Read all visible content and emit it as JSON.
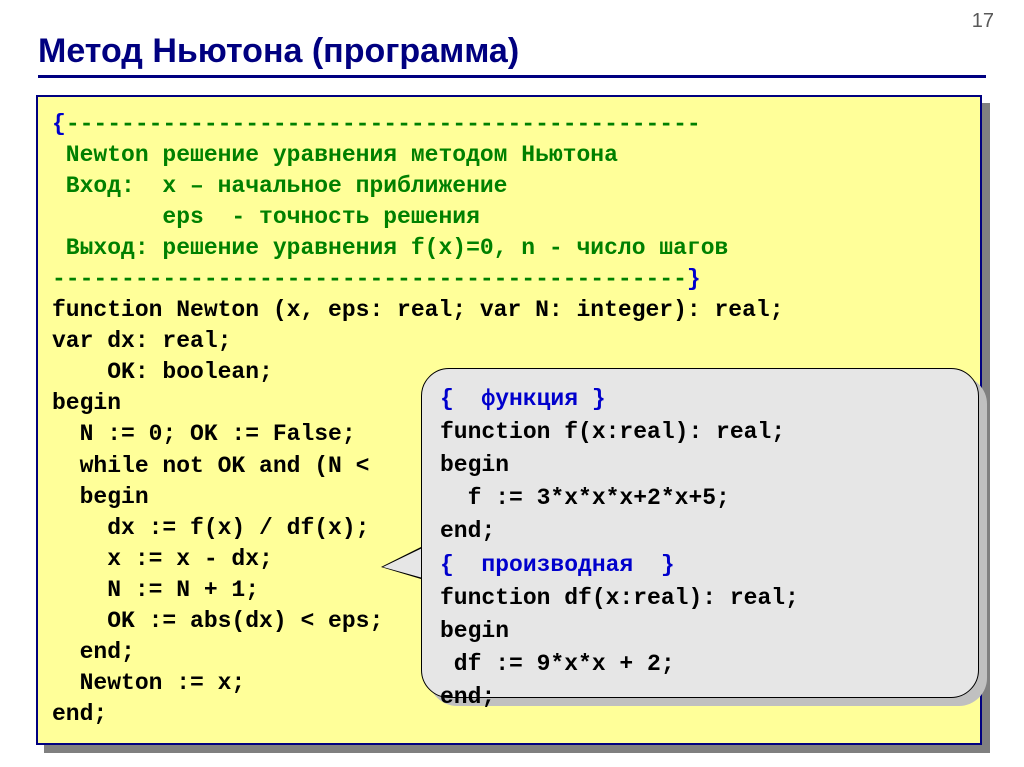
{
  "page_number": "17",
  "title": "Метод Ньютона (программа)",
  "code": {
    "l1a": "{",
    "l1b": "----------------------------------------------",
    "l2": " Newton решение уравнения методом Ньютона",
    "l3": " Вход:  x – начальное приближение",
    "l4": "        eps  - точность решения",
    "l5": " Выход: решение уравнения f(x)=0, n - число шагов",
    "l6a": "----------------------------------------------",
    "l6b": "}",
    "l7": "function Newton (x, eps: real; var N: integer): real;",
    "l8": "var dx: real;",
    "l9": "    OK: boolean;",
    "l10": "begin",
    "l11": "  N := 0; OK := False;",
    "l12": "  while not OK and (N <",
    "l13": "  begin",
    "l14": "    dx := f(x) / df(x);",
    "l15": "    x := x - dx;",
    "l16": "    N := N + 1;",
    "l17": "    OK := abs(dx) < eps;",
    "l18": "  end;",
    "l19": "  Newton := x;",
    "l20": "end;"
  },
  "callout": {
    "l1": "{  функция }",
    "l2": "function f(x:real): real;",
    "l3": "begin",
    "l4": "  f := 3*x*x*x+2*x+5;",
    "l5": "end;",
    "l6": "{  производная  }",
    "l7": "function df(x:real): real;",
    "l8": "begin",
    "l9": " df := 9*x*x + 2;",
    "l10": "end;"
  }
}
